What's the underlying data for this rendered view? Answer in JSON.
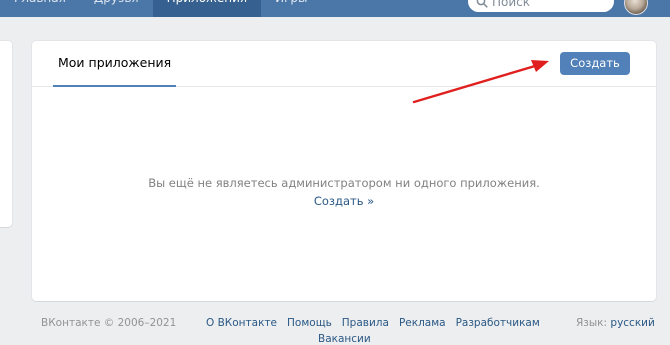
{
  "header": {
    "nav_items": [
      {
        "label": "Главная"
      },
      {
        "label": "Друзья"
      },
      {
        "label": "Приложения"
      },
      {
        "label": "Игры"
      }
    ],
    "search_placeholder": "Поиск",
    "search_icon": "search-icon",
    "avatar_icon": "user-avatar"
  },
  "apps_card": {
    "tab_label": "Мои приложения",
    "create_button": "Создать",
    "empty_message": "Вы ещё не являетесь администратором ни одного приложения.",
    "empty_link": "Создать »"
  },
  "annotation": {
    "arrow_color": "#e0201f",
    "points_to": "create-button"
  },
  "footer": {
    "copyright": "ВКонтакте © 2006–2021",
    "links": [
      "О ВКонтакте",
      "Помощь",
      "Правила",
      "Реклама",
      "Разработчикам",
      "Вакансии"
    ],
    "language_label": "Язык:",
    "language_value": "русский"
  },
  "colors": {
    "brand_blue": "#4a76a8",
    "button_blue": "#5181b8",
    "link_blue": "#2a5885",
    "page_bg": "#edeef0"
  }
}
